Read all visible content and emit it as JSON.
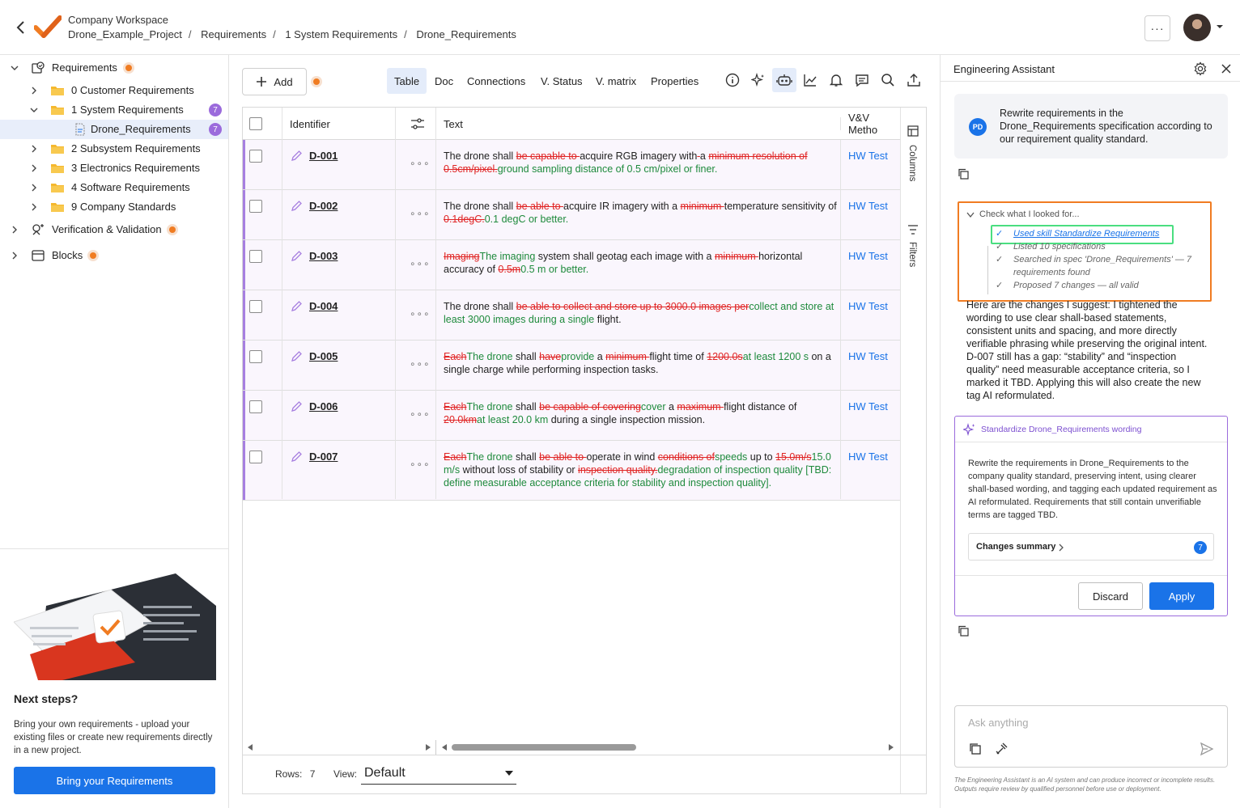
{
  "header": {
    "workspace": "Company Workspace",
    "breadcrumbs": [
      "Drone_Example_Project",
      "Requirements",
      "1 System Requirements",
      "Drone_Requirements"
    ],
    "more_label": "···"
  },
  "tree": {
    "items": [
      {
        "label": "Requirements",
        "type": "root"
      },
      {
        "label": "0 Customer Requirements",
        "type": "folder"
      },
      {
        "label": "1 System Requirements",
        "type": "folder",
        "badge": "7"
      },
      {
        "label": "Drone_Requirements",
        "type": "doc",
        "badge": "7"
      },
      {
        "label": "2 Subsystem Requirements",
        "type": "folder"
      },
      {
        "label": "3 Electronics Requirements",
        "type": "folder"
      },
      {
        "label": "4 Software Requirements",
        "type": "folder"
      },
      {
        "label": "9 Company Standards",
        "type": "folder"
      },
      {
        "label": "Verification & Validation",
        "type": "root"
      },
      {
        "label": "Blocks",
        "type": "root"
      }
    ]
  },
  "promo": {
    "title": "Next steps?",
    "text": "Bring your own requirements - upload your existing files or create new requirements directly in a new project.",
    "button": "Bring your Requirements"
  },
  "toolbar": {
    "add_label": "Add",
    "tabs": [
      "Table",
      "Doc",
      "Connections",
      "V. Status",
      "V. matrix",
      "Properties"
    ],
    "active_tab": "Table"
  },
  "table": {
    "headers": {
      "identifier": "Identifier",
      "text": "Text",
      "vv": "V&V Metho"
    },
    "side_tabs": [
      "Columns",
      "Filters"
    ],
    "rows": [
      {
        "id": "D-001",
        "vv": "HW Test",
        "segments": [
          {
            "t": "n",
            "s": "The drone shall "
          },
          {
            "t": "d",
            "s": "be capable to "
          },
          {
            "t": "n",
            "s": "acquire RGB imagery with"
          },
          {
            "t": "d",
            "s": " "
          },
          {
            "t": "n",
            "s": " a "
          },
          {
            "t": "d",
            "s": "minimum resolution of 0.5cm/pixel."
          },
          {
            "t": "i",
            "s": "ground sampling distance of 0.5 cm/pixel or finer."
          }
        ]
      },
      {
        "id": "D-002",
        "vv": "HW Test",
        "segments": [
          {
            "t": "n",
            "s": "The drone shall "
          },
          {
            "t": "d",
            "s": "be able to "
          },
          {
            "t": "n",
            "s": "acquire IR imagery with a "
          },
          {
            "t": "d",
            "s": "minimum "
          },
          {
            "t": "n",
            "s": "temperature sensitivity of "
          },
          {
            "t": "d",
            "s": "0.1degC."
          },
          {
            "t": "i",
            "s": "0.1 degC or better."
          }
        ]
      },
      {
        "id": "D-003",
        "vv": "HW Test",
        "segments": [
          {
            "t": "d",
            "s": "Imaging"
          },
          {
            "t": "i",
            "s": "The imaging"
          },
          {
            "t": "n",
            "s": " system shall geotag each image with a "
          },
          {
            "t": "d",
            "s": "minimum "
          },
          {
            "t": "n",
            "s": "horizontal accuracy of "
          },
          {
            "t": "d",
            "s": "0.5m"
          },
          {
            "t": "i",
            "s": "0.5 m or better."
          }
        ]
      },
      {
        "id": "D-004",
        "vv": "HW Test",
        "segments": [
          {
            "t": "n",
            "s": "The drone shall "
          },
          {
            "t": "d",
            "s": "be able to collect and store up to 3000.0 images per"
          },
          {
            "t": "i",
            "s": "collect and store at least 3000 images during a single"
          },
          {
            "t": "n",
            "s": " flight."
          }
        ]
      },
      {
        "id": "D-005",
        "vv": "HW Test",
        "segments": [
          {
            "t": "d",
            "s": "Each"
          },
          {
            "t": "i",
            "s": "The drone"
          },
          {
            "t": "n",
            "s": " shall "
          },
          {
            "t": "d",
            "s": "have"
          },
          {
            "t": "i",
            "s": "provide"
          },
          {
            "t": "n",
            "s": " a "
          },
          {
            "t": "d",
            "s": "minimum "
          },
          {
            "t": "n",
            "s": "flight time of "
          },
          {
            "t": "d",
            "s": "1200.0s"
          },
          {
            "t": "i",
            "s": "at least 1200 s"
          },
          {
            "t": "n",
            "s": " on a single charge while performing inspection tasks."
          }
        ]
      },
      {
        "id": "D-006",
        "vv": "HW Test",
        "segments": [
          {
            "t": "d",
            "s": "Each"
          },
          {
            "t": "i",
            "s": "The drone"
          },
          {
            "t": "n",
            "s": " shall "
          },
          {
            "t": "d",
            "s": "be capable of covering"
          },
          {
            "t": "i",
            "s": "cover"
          },
          {
            "t": "n",
            "s": " a "
          },
          {
            "t": "d",
            "s": "maximum "
          },
          {
            "t": "n",
            "s": "flight distance of "
          },
          {
            "t": "d",
            "s": "20.0km"
          },
          {
            "t": "i",
            "s": "at least 20.0 km"
          },
          {
            "t": "n",
            "s": " during a single inspection mission."
          }
        ]
      },
      {
        "id": "D-007",
        "vv": "HW Test",
        "segments": [
          {
            "t": "d",
            "s": "Each"
          },
          {
            "t": "i",
            "s": "The drone"
          },
          {
            "t": "n",
            "s": " shall "
          },
          {
            "t": "d",
            "s": "be able to "
          },
          {
            "t": "n",
            "s": "operate in wind "
          },
          {
            "t": "d",
            "s": "conditions of"
          },
          {
            "t": "i",
            "s": "speeds"
          },
          {
            "t": "n",
            "s": " up to "
          },
          {
            "t": "d",
            "s": "15.0m/s"
          },
          {
            "t": "i",
            "s": "15.0 m/s"
          },
          {
            "t": "n",
            "s": " without loss of stability or "
          },
          {
            "t": "d",
            "s": "inspection quality."
          },
          {
            "t": "i",
            "s": "degradation of inspection quality [TBD: define measurable acceptance criteria for stability and inspection quality]."
          }
        ]
      }
    ]
  },
  "footer": {
    "rows_label": "Rows:",
    "rows_value": "7",
    "view_label": "View:",
    "view_value": "Default"
  },
  "assistant": {
    "title": "Engineering Assistant",
    "user_initials": "PD",
    "user_message": "Rewrite requirements in the Drone_Requirements specification according to our requirement quality standard.",
    "check_title": "Check what I looked for...",
    "steps": [
      "Used skill Standardize Requirements",
      "Listed 10 specifications",
      "Searched in spec 'Drone_Requirements' — 7",
      "requirements found",
      "Proposed 7 changes — all valid"
    ],
    "reply": "Here are the changes I suggest: I tightened the wording to use clear shall-based statements, consistent units and spacing, and more directly verifiable phrasing while preserving the original intent. D-007 still has a gap: “stability” and “inspection quality” need measurable acceptance criteria, so I marked it TBD. Applying this will also create the new tag AI reformulated.",
    "card": {
      "title": "Standardize Drone_Requirements wording",
      "body": "Rewrite the requirements in Drone_Requirements to the company quality standard, preserving intent, using clearer shall-based wording, and tagging each updated requirement as AI reformulated. Requirements that still contain unverifiable terms are tagged TBD.",
      "changes_label": "Changes summary",
      "changes_count": "7",
      "discard": "Discard",
      "apply": "Apply"
    },
    "input_placeholder": "Ask anything",
    "disclaimer": "The Engineering Assistant is an AI system and can produce incorrect or incomplete results. Outputs require review by qualified personnel before use or deployment."
  },
  "colors": {
    "accent": "#1a73e8",
    "orange": "#f07c22",
    "purple": "#9b6bdc",
    "deleted": "#e02424",
    "inserted": "#1e8a3c",
    "highlight": "#4ade80"
  }
}
